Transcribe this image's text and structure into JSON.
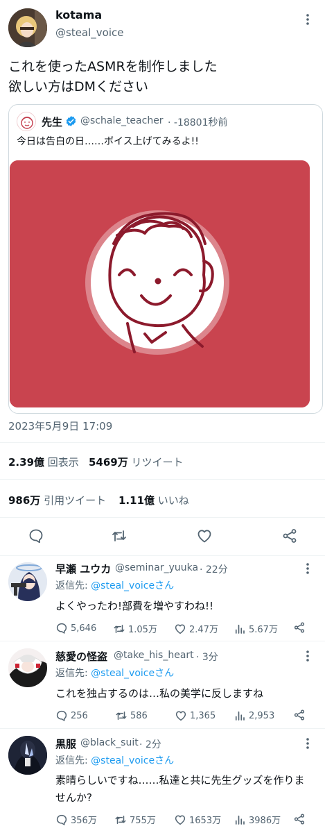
{
  "main_tweet": {
    "display_name": "kotama",
    "handle": "@steal_voice",
    "text_line1": "これを使ったASMRを制作しました",
    "text_line2": "欲しい方はDMください",
    "quoted": {
      "display_name": "先生",
      "handle": "@schale_teacher",
      "time": "· -18801秒前",
      "text": "今日は告白の日……ボイス上げてみるよ!!",
      "image_bg": "#c9444f"
    },
    "timestamp": "2023年5月9日 17:09",
    "stats": {
      "views_value": "2.39億",
      "views_label": "回表示",
      "retweets_value": "5469万",
      "retweets_label": "リツイート",
      "quotes_value": "986万",
      "quotes_label": "引用ツイート",
      "likes_value": "1.11億",
      "likes_label": "いいね"
    }
  },
  "replies": [
    {
      "display_name": "早瀬 ユウカ",
      "handle": "@seminar_yuuka",
      "time": "· 22分",
      "reply_prefix": "返信先: ",
      "reply_to": "@steal_voiceさん",
      "text": "よくやったわ!部費を増やすわね!!",
      "comments": "5,646",
      "retweets": "1.05万",
      "likes": "2.47万",
      "views": "5.67万"
    },
    {
      "display_name": "慈愛の怪盗",
      "handle": "@take_his_heart",
      "time": "· 3分",
      "reply_prefix": "返信先: ",
      "reply_to": "@steal_voiceさん",
      "text": "これを独占するのは…私の美学に反しますね",
      "comments": "256",
      "retweets": "586",
      "likes": "1,365",
      "views": "2,953"
    },
    {
      "display_name": "黒服",
      "handle": "@black_suit",
      "time": "· 2分",
      "reply_prefix": "返信先: ",
      "reply_to": "@steal_voiceさん",
      "text_line1": "素晴らしいですね……私達と共に先生グッズを作りま",
      "text_line2": "せんか?",
      "comments": "356万",
      "retweets": "755万",
      "likes": "1653万",
      "views": "3986万"
    }
  ],
  "colors": {
    "accent": "#1d9bf0",
    "text": "#0f1419",
    "secondary": "#536471",
    "divider": "#eff3f4"
  }
}
